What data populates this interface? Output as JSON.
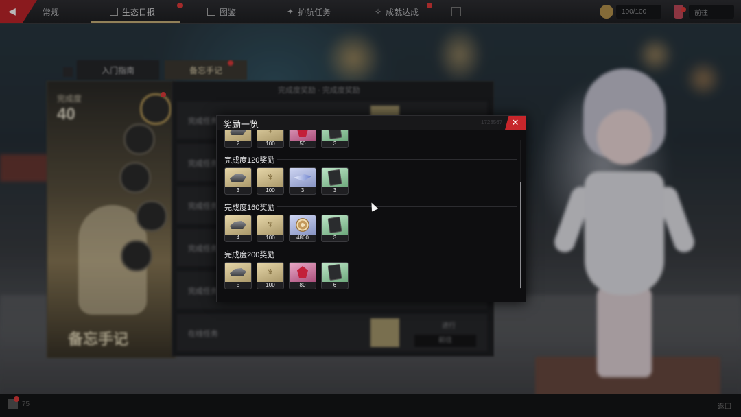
{
  "window": {
    "title": "奖励一览",
    "code_text": "1723567"
  },
  "top_nav": {
    "back_label": "◀",
    "tabs": [
      {
        "label": "常规"
      },
      {
        "label": "生态日报"
      },
      {
        "label": "图鉴"
      },
      {
        "label": "护航任务"
      },
      {
        "label": "成就达成"
      }
    ],
    "currencies": [
      "100/100",
      "前往"
    ]
  },
  "side_tabs": [
    "入门指南",
    "备忘手记"
  ],
  "left_card": {
    "label": "完成度",
    "value": "40",
    "title": "备忘手记"
  },
  "list_panel": {
    "header": "完成度奖励 · 完成度奖励",
    "rows": [
      "完成任务",
      "完成任务",
      "完成任务",
      "完成任务",
      "完成任务",
      "在线任务"
    ],
    "status": "进行",
    "button_label": "前往"
  },
  "bottom_bar": {
    "left": "75",
    "right": "返回"
  },
  "modal": {
    "close_icon": "close-icon",
    "top_row": [
      {
        "icon": "ore-icon",
        "count": "2",
        "color": "#e6d6a8"
      },
      {
        "icon": "horns-icon",
        "count": "100",
        "color": "#e6d6a8"
      },
      {
        "icon": "gem-icon",
        "count": "50",
        "color": "#e9a9c6"
      },
      {
        "icon": "card-icon",
        "count": "3",
        "color": "#bfe6c9"
      }
    ],
    "sections": [
      {
        "title": "完成度120奖励",
        "items": [
          {
            "icon": "ore-icon",
            "count": "3",
            "color": "#e6d6a8"
          },
          {
            "icon": "horns-icon",
            "count": "100",
            "color": "#e6d6a8"
          },
          {
            "icon": "shard-icon",
            "count": "3",
            "color": "#cfd6f3"
          },
          {
            "icon": "card-icon",
            "count": "3",
            "color": "#bfe6c9"
          }
        ]
      },
      {
        "title": "完成度160奖励",
        "items": [
          {
            "icon": "ore-icon",
            "count": "4",
            "color": "#e6d6a8"
          },
          {
            "icon": "horns-icon",
            "count": "100",
            "color": "#e6d6a8"
          },
          {
            "icon": "snail-shell-icon",
            "count": "4800",
            "color": "#cfd6f3"
          },
          {
            "icon": "card-icon",
            "count": "3",
            "color": "#bfe6c9"
          }
        ]
      },
      {
        "title": "完成度200奖励",
        "items": [
          {
            "icon": "ore-icon",
            "count": "5",
            "color": "#e6d6a8"
          },
          {
            "icon": "horns-icon",
            "count": "100",
            "color": "#e6d6a8"
          },
          {
            "icon": "gem-icon",
            "count": "80",
            "color": "#e9a9c6"
          },
          {
            "icon": "card-icon",
            "count": "6",
            "color": "#bfe6c9"
          }
        ]
      }
    ]
  }
}
